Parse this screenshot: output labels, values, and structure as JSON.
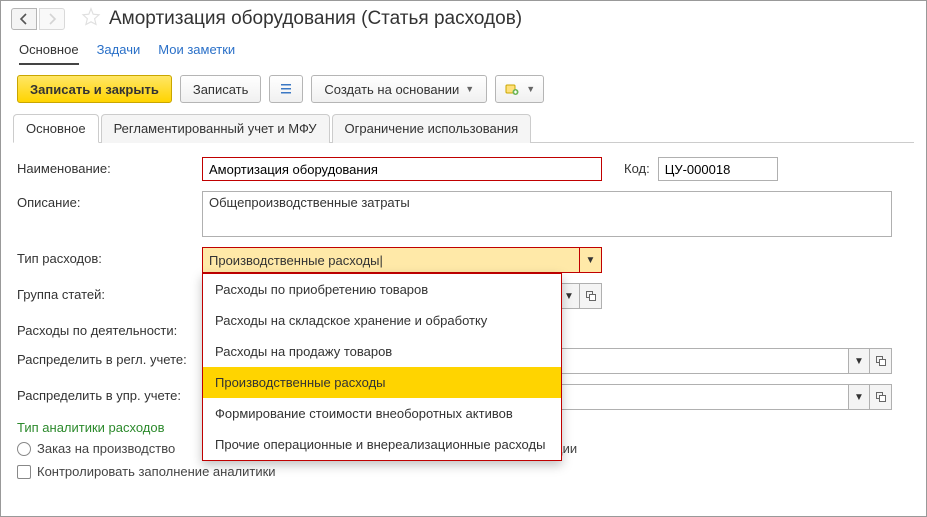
{
  "header": {
    "title": "Амортизация оборудования (Статья расходов)"
  },
  "mainTabs": {
    "items": [
      {
        "label": "Основное",
        "active": true,
        "name": "main-tab-main"
      },
      {
        "label": "Задачи",
        "active": false,
        "name": "main-tab-tasks"
      },
      {
        "label": "Мои заметки",
        "active": false,
        "name": "main-tab-notes"
      }
    ]
  },
  "toolbar": {
    "writeAndClose": "Записать и закрыть",
    "write": "Записать",
    "createBased": "Создать на основании"
  },
  "subTabs": {
    "items": [
      {
        "label": "Основное",
        "active": true,
        "name": "sub-tab-main"
      },
      {
        "label": "Регламентированный учет и МФУ",
        "active": false,
        "name": "sub-tab-reg"
      },
      {
        "label": "Ограничение использования",
        "active": false,
        "name": "sub-tab-limit"
      }
    ]
  },
  "labels": {
    "name": "Наименование:",
    "desc": "Описание:",
    "type": "Тип расходов:",
    "group": "Группа статей:",
    "activity": "Расходы по деятельности:",
    "distReg": "Распределить в регл. учете:",
    "distMgmt": "Распределить в упр. учете:",
    "code": "Код:",
    "analytics": "Тип аналитики расходов",
    "radioOrder": "Заказ на производство",
    "checkControl": "Контролировать заполнение аналитики",
    "trailing": "луатации"
  },
  "values": {
    "name": "Амортизация оборудования",
    "desc": "Общепроизводственные затраты",
    "type": "Производственные расходы",
    "code": "ЦУ-000018"
  },
  "dropdown": {
    "options": [
      "Расходы по приобретению товаров",
      "Расходы на складское хранение и обработку",
      "Расходы на продажу товаров",
      "Производственные расходы",
      "Формирование стоимости внеоборотных активов",
      "Прочие операционные и внереализационные расходы"
    ],
    "selectedIndex": 3
  }
}
